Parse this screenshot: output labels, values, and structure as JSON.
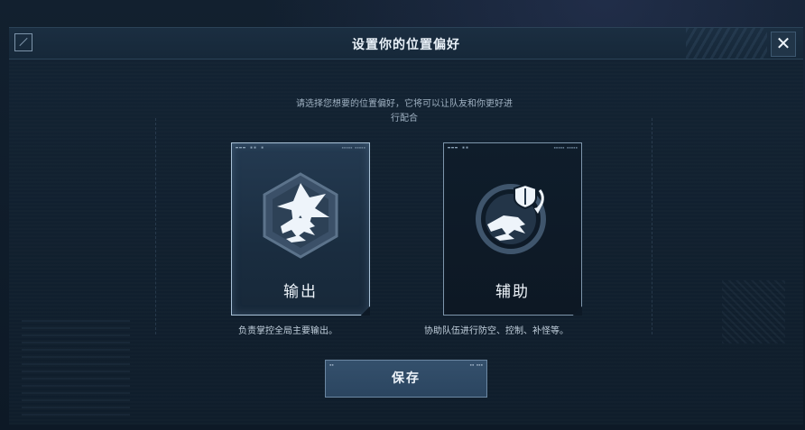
{
  "dialog": {
    "title": "设置你的位置偏好",
    "close_symbol": "✕",
    "description": "请选择您想要的位置偏好，它将可以让队友和你更好进行配合"
  },
  "options": [
    {
      "label": "输出",
      "caption": "负责掌控全局主要输出。",
      "icon": "dragon-burst-icon",
      "selected": true
    },
    {
      "label": "辅助",
      "caption": "协助队伍进行防空、控制、补怪等。",
      "icon": "dragon-shield-icon",
      "selected": false
    }
  ],
  "save_button": {
    "label": "保存"
  },
  "colors": {
    "panel": "#132333",
    "accent_border": "#a9c2d8",
    "button": "#34506c"
  }
}
